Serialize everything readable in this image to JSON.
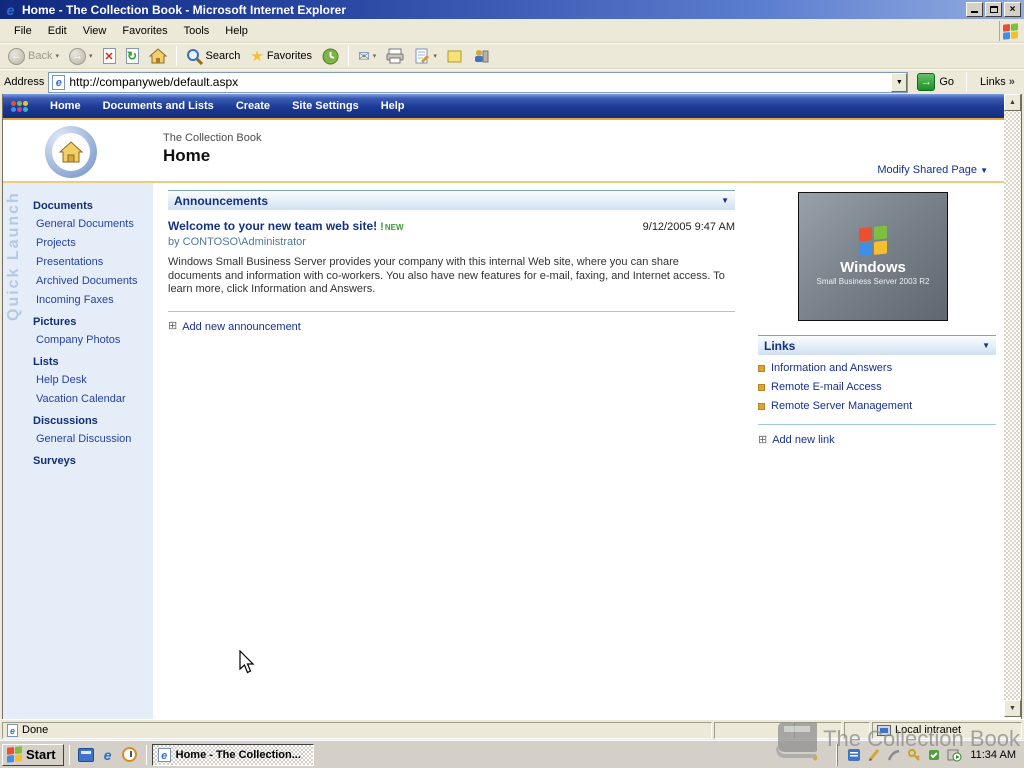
{
  "window": {
    "title": "Home - The Collection Book - Microsoft Internet Explorer"
  },
  "menu": {
    "items": [
      "File",
      "Edit",
      "View",
      "Favorites",
      "Tools",
      "Help"
    ]
  },
  "toolbar": {
    "back_label": "Back",
    "search_label": "Search",
    "favorites_label": "Favorites"
  },
  "address": {
    "label": "Address",
    "value": "http://companyweb/default.aspx",
    "go_label": "Go",
    "links_label": "Links"
  },
  "spnav": {
    "items": [
      "Home",
      "Documents and Lists",
      "Create",
      "Site Settings",
      "Help"
    ]
  },
  "header": {
    "site_name": "The Collection Book",
    "page_title": "Home",
    "modify_label": "Modify Shared Page"
  },
  "sidebar": {
    "vertical_label": "Quick Launch",
    "groups": [
      {
        "label": "Documents",
        "items": [
          "General Documents",
          "Projects",
          "Presentations",
          "Archived Documents",
          "Incoming Faxes"
        ]
      },
      {
        "label": "Pictures",
        "items": [
          "Company Photos"
        ]
      },
      {
        "label": "Lists",
        "items": [
          "Help Desk",
          "Vacation Calendar"
        ]
      },
      {
        "label": "Discussions",
        "items": [
          "General Discussion"
        ]
      },
      {
        "label": "Surveys",
        "items": []
      }
    ]
  },
  "announcements": {
    "title": "Announcements",
    "item": {
      "title": "Welcome to your new team web site!",
      "new_bang": "!",
      "new_label": "NEW",
      "date": "9/12/2005 9:47 AM",
      "byline": "by CONTOSO\\Administrator",
      "body": "Windows Small Business Server provides your company with this internal Web site, where you can share documents and information with co-workers. You also have new features for e-mail, faxing, and Internet access. To learn more, click Information and Answers."
    },
    "add_label": "Add new announcement"
  },
  "links_section": {
    "title": "Links",
    "items": [
      "Information and Answers",
      "Remote E-mail Access",
      "Remote Server Management"
    ],
    "add_label": "Add new link"
  },
  "sbs_image": {
    "line1": "Windows",
    "line2": "Small Business Server 2003 R2"
  },
  "statusbar": {
    "status_text": "Done",
    "zone_label": "Local intranet"
  },
  "taskbar": {
    "start_label": "Start",
    "task_label": "Home - The Collection...",
    "clock": "11:34 AM"
  },
  "watermark": {
    "text": "The Collection Book"
  },
  "icons": {
    "caret_down": "▼",
    "small_caret": "▾",
    "chevron_double": "»",
    "plus_box": "⊞",
    "up_arrow": "▲",
    "down_arrow": "▼",
    "back_arrow": "←",
    "fwd_arrow": "→",
    "stop_x": "✕",
    "refresh": "↻",
    "star": "★",
    "mail": "✉",
    "e_glyph": "e",
    "close_x": "×"
  },
  "colors": {
    "nav_blue": "#16338c",
    "accent_orange": "#e9a43b",
    "link_navy": "#17318f",
    "new_green": "#3d9b35",
    "bullet_gold": "#e0a338",
    "sidebar_bg": "#e4edf8"
  }
}
